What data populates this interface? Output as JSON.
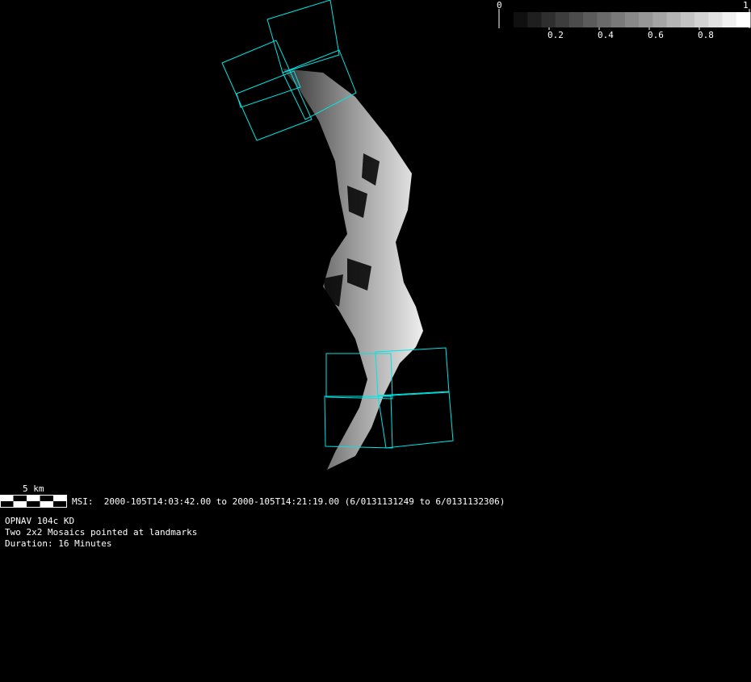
{
  "colorbar": {
    "min_label": "0",
    "max_label": "1",
    "ticks": [
      "0.2",
      "0.4",
      "0.6",
      "0.8"
    ],
    "levels": 17
  },
  "scale_bar": {
    "label": "5 km"
  },
  "msi_line": "MSI:  2000-105T14:03:42.00 to 2000-105T14:21:19.00 (6/0131131249 to 6/0131132306)",
  "info": {
    "line1": "OPNAV 104c KD",
    "line2": "Two 2x2 Mosaics pointed at landmarks",
    "line3": "Duration: 16 Minutes"
  },
  "colors": {
    "footprint": "#00e5e5",
    "background": "#000000"
  }
}
